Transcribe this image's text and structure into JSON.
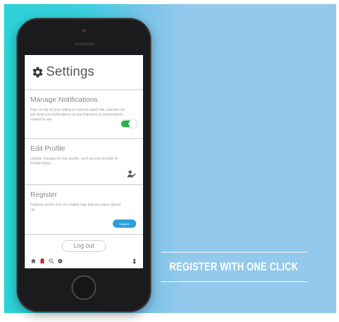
{
  "app": {
    "title": "Settings"
  },
  "sections": {
    "notifications": {
      "title": "Manage Notifications",
      "description": "Stay on top of your voting no need to watch the calender we will send you notifications on any Elections or referendums related to you.",
      "toggle_on": true
    },
    "edit_profile": {
      "title": "Edit Profile",
      "description": "Update changes to your profile, such as your location & Profile Photo."
    },
    "register": {
      "title": "Register",
      "description": "Register at the click of a button now that you have signed up.",
      "button_label": "Register"
    }
  },
  "logout_label": "Log out",
  "bottom_nav": {
    "icons": [
      "home-icon",
      "ballot-icon",
      "search-icon",
      "settings-icon",
      "profile-icon"
    ]
  },
  "banner": {
    "text": "REGISTER WITH ONE CLICK"
  },
  "colors": {
    "accent_green": "#2db24f",
    "accent_blue": "#2f9ed8",
    "background_teal": "#2ad3d6",
    "background_blue": "#93c9ec"
  }
}
